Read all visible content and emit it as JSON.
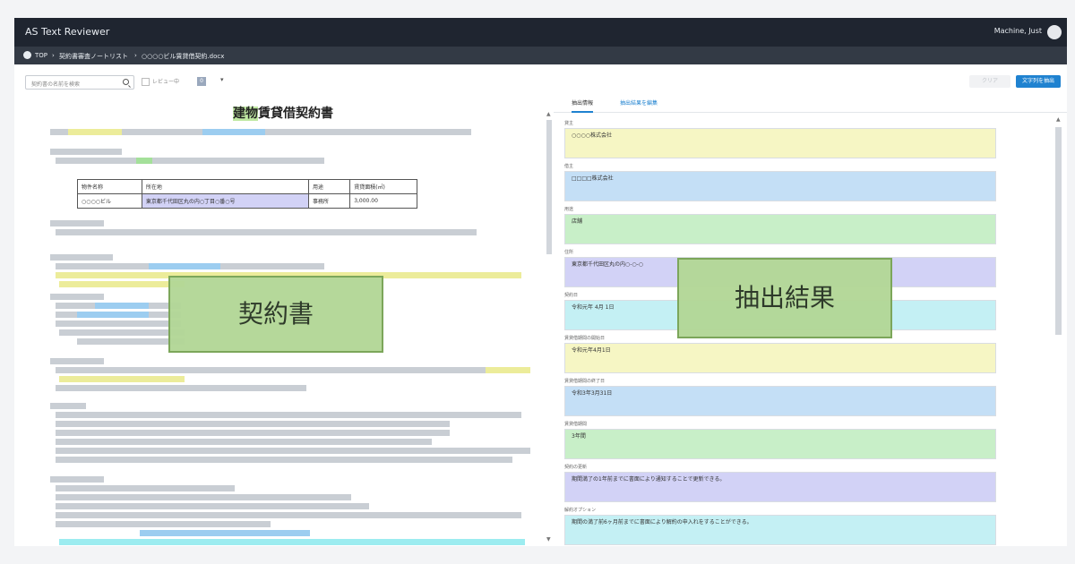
{
  "app": {
    "title": "AS Text Reviewer",
    "user_name": "Machine, Just"
  },
  "breadcrumb": [
    "TOP",
    "契約書審査ノートリスト",
    "○○○○ビル賃貸借契約.docx"
  ],
  "toolbar": {
    "search_placeholder": "契約書の名前を検索",
    "checkbox_label": "レビュー中",
    "count_badge": "0",
    "dropdown_label": "▾",
    "clear_label": "クリア",
    "primary_label": "文字列を抽出"
  },
  "document": {
    "title_highlight": "建物",
    "title_rest": "賃貸借契約書",
    "table": [
      [
        "物件名称",
        "所在地",
        "用途",
        "賃貸面積(㎡)"
      ],
      [
        "○○○○ビル",
        "東京都千代田区丸の内○丁目○番○号",
        "事務所",
        "3,000.00"
      ]
    ]
  },
  "extract": {
    "tabs": [
      "抽出情報",
      "抽出結果を編集"
    ],
    "fields": [
      {
        "label": "貸主",
        "value": "○○○○株式会社",
        "color": "#f6f6c4"
      },
      {
        "label": "借主",
        "value": "□□□□株式会社",
        "color": "#c4dff6"
      },
      {
        "label": "用途",
        "value": "店舗",
        "color": "#c8efc8"
      },
      {
        "label": "住所",
        "value": "東京都千代田区丸の内○-○-○",
        "color": "#d2d2f6"
      },
      {
        "label": "契約日",
        "value": "令和元年 4月 1日",
        "color": "#c4f0f4"
      },
      {
        "label": "賃貸借期間の開始日",
        "value": "令和元年4月1日",
        "color": "#f6f6c4"
      },
      {
        "label": "賃貸借期間の終了日",
        "value": "令和3年3月31日",
        "color": "#c4dff6"
      },
      {
        "label": "賃貸借期間",
        "value": "3年間",
        "color": "#c8efc8"
      },
      {
        "label": "契約の更新",
        "value": "期間満了の1年前までに書面により通知することで更新できる。",
        "color": "#d2d2f6"
      },
      {
        "label": "解約オプション",
        "value": "期間の満了前6ヶ月前までに書面により解約の申入れをすることができる。",
        "color": "#c4f0f4"
      }
    ]
  },
  "overlays": {
    "document_label": "契約書",
    "result_label": "抽出結果"
  }
}
